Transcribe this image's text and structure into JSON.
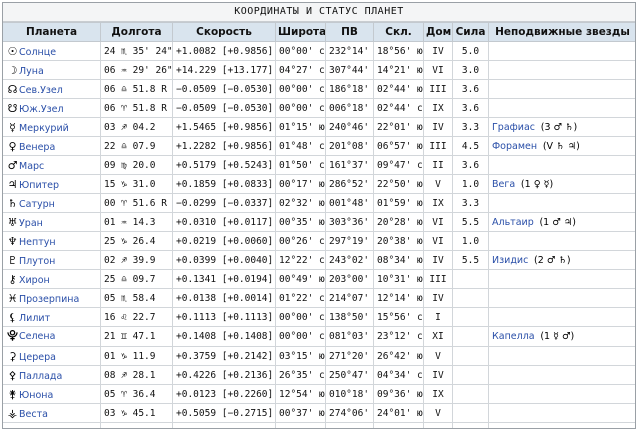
{
  "title": "КООРДИНАТЫ И СТАТУС ПЛАНЕТ",
  "headers": [
    "Планета",
    "Долгота",
    "Скорость",
    "Широта",
    "ПВ",
    "Скл.",
    "Дом",
    "Сила",
    "Неподвижные звезды"
  ],
  "rows": [
    {
      "glyph": "☉",
      "icon": "sun-icon",
      "name": "Солнце",
      "lon": "24 ♏ 35' 24\"",
      "speed": "+1.0082 [+0.9856]",
      "lat": "00°00' с",
      "ra": "232°14'",
      "decl": "18°56' ю",
      "house": "IV",
      "power": "5.0",
      "star": "",
      "aspect": ""
    },
    {
      "glyph": "☽",
      "icon": "moon-icon",
      "name": "Луна",
      "lon": "06 ♒ 29' 26\"",
      "speed": "+14.229 [+13.177]",
      "lat": "04°27' с",
      "ra": "307°44'",
      "decl": "14°21' ю",
      "house": "VI",
      "power": "3.0",
      "star": "",
      "aspect": ""
    },
    {
      "glyph": "☊",
      "icon": "north-node-icon",
      "name": "Сев.Узел",
      "lon": "06 ♎ 51.8 R",
      "speed": "−0.0509 [−0.0530]",
      "lat": "00°00' с",
      "ra": "186°18'",
      "decl": "02°44' ю",
      "house": "III",
      "power": "3.6",
      "star": "",
      "aspect": ""
    },
    {
      "glyph": "☋",
      "icon": "south-node-icon",
      "name": "Юж.Узел",
      "lon": "06 ♈ 51.8 R",
      "speed": "−0.0509 [−0.0530]",
      "lat": "00°00' с",
      "ra": "006°18'",
      "decl": "02°44' с",
      "house": "IX",
      "power": "3.6",
      "star": "",
      "aspect": ""
    },
    {
      "glyph": "☿",
      "icon": "mercury-icon",
      "name": "Меркурий",
      "lon": "03 ♐ 04.2",
      "speed": "+1.5465 [+0.9856]",
      "lat": "01°15' ю",
      "ra": "240°46'",
      "decl": "22°01' ю",
      "house": "IV",
      "power": "3.3",
      "star": "Графиас",
      "aspect": "(3 ♂ ♄)"
    },
    {
      "glyph": "♀",
      "icon": "venus-icon",
      "name": "Венера",
      "lon": "22 ♎ 07.9",
      "speed": "+1.2282 [+0.9856]",
      "lat": "01°48' с",
      "ra": "201°08'",
      "decl": "06°57' ю",
      "house": "III",
      "power": "4.5",
      "star": "Форамен",
      "aspect": "(V ♄ ♃)"
    },
    {
      "glyph": "♂",
      "icon": "mars-icon",
      "name": "Марс",
      "lon": "09 ♍ 20.0",
      "speed": "+0.5179 [+0.5243]",
      "lat": "01°50' с",
      "ra": "161°37'",
      "decl": "09°47' с",
      "house": "II",
      "power": "3.6",
      "star": "",
      "aspect": ""
    },
    {
      "glyph": "♃",
      "icon": "jupiter-icon",
      "name": "Юпитер",
      "lon": "15 ♑ 31.0",
      "speed": "+0.1859 [+0.0833]",
      "lat": "00°17' ю",
      "ra": "286°52'",
      "decl": "22°50' ю",
      "house": "V",
      "power": "1.0",
      "star": "Вега",
      "aspect": "(1 ♀ ☿)"
    },
    {
      "glyph": "♄",
      "icon": "saturn-icon",
      "name": "Сатурн",
      "lon": "00 ♈ 51.6 R",
      "speed": "−0.0299 [−0.0337]",
      "lat": "02°32' ю",
      "ra": "001°48'",
      "decl": "01°59' ю",
      "house": "IX",
      "power": "3.3",
      "star": "",
      "aspect": ""
    },
    {
      "glyph": "♅",
      "icon": "uranus-icon",
      "name": "Уран",
      "lon": "01 ♒ 14.3",
      "speed": "+0.0310 [+0.0117]",
      "lat": "00°35' ю",
      "ra": "303°36'",
      "decl": "20°28' ю",
      "house": "VI",
      "power": "5.5",
      "star": "Альтаир",
      "aspect": "(1 ♂ ♃)"
    },
    {
      "glyph": "♆",
      "icon": "neptune-icon",
      "name": "Нептун",
      "lon": "25 ♑ 26.4",
      "speed": "+0.0219 [+0.0060]",
      "lat": "00°26' с",
      "ra": "297°19'",
      "decl": "20°38' ю",
      "house": "VI",
      "power": "1.0",
      "star": "",
      "aspect": ""
    },
    {
      "glyph": "♇",
      "icon": "pluto-icon",
      "name": "Плутон",
      "lon": "02 ♐ 39.9",
      "speed": "+0.0399 [+0.0040]",
      "lat": "12°22' с",
      "ra": "243°02'",
      "decl": "08°34' ю",
      "house": "IV",
      "power": "5.5",
      "star": "Изидис",
      "aspect": "(2 ♂ ♄)"
    },
    {
      "glyph": "⚷",
      "icon": "chiron-icon",
      "name": "Хирон",
      "lon": "25 ♎ 09.7",
      "speed": "+0.1341 [+0.0194]",
      "lat": "00°49' ю",
      "ra": "203°00'",
      "decl": "10°31' ю",
      "house": "III",
      "power": "",
      "star": "",
      "aspect": ""
    },
    {
      "glyph": "♓",
      "icon": "proserpina-icon",
      "name": "Прозерпина",
      "lon": "05 ♏ 58.4",
      "speed": "+0.0138 [+0.0014]",
      "lat": "01°22' с",
      "ra": "214°07'",
      "decl": "12°14' ю",
      "house": "IV",
      "power": "",
      "star": "",
      "aspect": ""
    },
    {
      "glyph": "⚸",
      "icon": "lilith-icon",
      "name": "Лилит",
      "lon": "16 ♌ 22.7",
      "speed": "+0.1113 [+0.1113]",
      "lat": "00°00' с",
      "ra": "138°50'",
      "decl": "15°56' с",
      "house": "I",
      "power": "",
      "star": "",
      "aspect": ""
    },
    {
      "glyph": "⯓",
      "icon": "selena-icon",
      "name": "Селена",
      "lon": "21 ♊ 47.1",
      "speed": "+0.1408 [+0.1408]",
      "lat": "00°00' с",
      "ra": "081°03'",
      "decl": "23°12' с",
      "house": "XI",
      "power": "",
      "star": "Капелла",
      "aspect": "(1 ☿ ♂)"
    },
    {
      "glyph": "⚳",
      "icon": "ceres-icon",
      "name": "Церера",
      "lon": "01 ♑ 11.9",
      "speed": "+0.3759 [+0.2142]",
      "lat": "03°15' ю",
      "ra": "271°20'",
      "decl": "26°42' ю",
      "house": "V",
      "power": "",
      "star": "",
      "aspect": ""
    },
    {
      "glyph": "⚴",
      "icon": "pallas-icon",
      "name": "Паллада",
      "lon": "08 ♐ 28.1",
      "speed": "+0.4226 [+0.2136]",
      "lat": "26°35' с",
      "ra": "250°47'",
      "decl": "04°34' с",
      "house": "IV",
      "power": "",
      "star": "",
      "aspect": ""
    },
    {
      "glyph": "⚵",
      "icon": "juno-icon",
      "name": "Юнона",
      "lon": "05 ♈ 36.4",
      "speed": "+0.0123 [+0.2260]",
      "lat": "12°54' ю",
      "ra": "010°18'",
      "decl": "09°36' ю",
      "house": "IX",
      "power": "",
      "star": "",
      "aspect": ""
    },
    {
      "glyph": "⚶",
      "icon": "vesta-icon",
      "name": "Веста",
      "lon": "03 ♑ 45.1",
      "speed": "+0.5059 [−0.2715]",
      "lat": "00°37' ю",
      "ra": "274°06'",
      "decl": "24°01' ю",
      "house": "V",
      "power": "",
      "star": "",
      "aspect": ""
    }
  ]
}
